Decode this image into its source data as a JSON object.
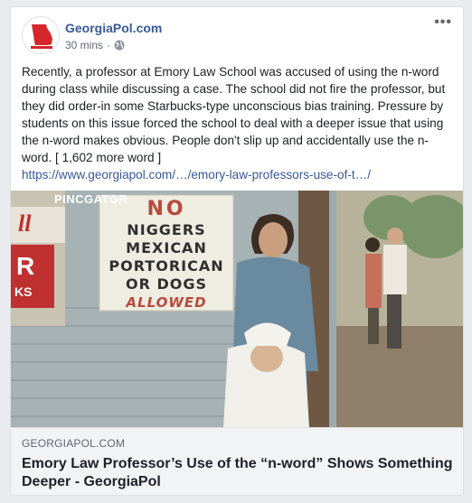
{
  "post": {
    "page_name": "GeorgiaPol.com",
    "timestamp": "30 mins",
    "separator": "·",
    "privacy_icon": "globe-icon",
    "more_icon": "ellipsis-icon",
    "more_label": "•••",
    "text": "Recently, a professor at Emory Law School was accused of using the n-word during class while discussing a case. The school did not fire the professor, but they did order-in some Starbucks-type unconscious bias training. Pressure by students on this issue forced the school to deal with a deeper issue that using the n-word makes obvious. People don't slip up and accidentally use the n-word. [ 1,602 more word ]",
    "link_text": "https://www.georgiapol.com/…/emory-law-professors-use-of-t…/"
  },
  "image": {
    "watermark": "PINCGATOR",
    "sign_lines": [
      "NO",
      "NIGGERS",
      "MEXICAN",
      "PORTORICAN",
      "OR DOGS",
      "ALLOWED"
    ],
    "left_sign_fragments": [
      "ll",
      "R",
      "KS"
    ]
  },
  "link_preview": {
    "domain": "GEORGIAPOL.COM",
    "title": "Emory Law Professor’s Use of the “n-word” Shows Something Deeper - GeorgiaPol"
  },
  "colors": {
    "link": "#385898",
    "avatar_red": "#d6262b",
    "footer_bg": "#f2f3f5"
  }
}
